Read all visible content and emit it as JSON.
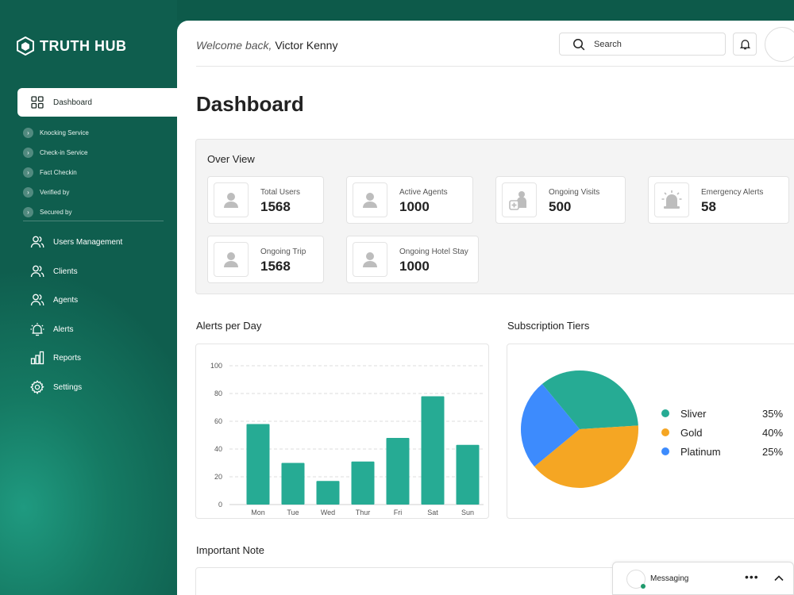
{
  "brand": {
    "name": "TRUTH HUB"
  },
  "sidebar": {
    "active": {
      "label": "Dashboard",
      "icon": "grid-icon"
    },
    "subitems": [
      {
        "label": "Knocking Service"
      },
      {
        "label": "Check-in Service"
      },
      {
        "label": "Fact Checkin"
      },
      {
        "label": "Verified by"
      },
      {
        "label": "Secured by"
      }
    ],
    "items": [
      {
        "label": "Users Management",
        "icon": "users-icon"
      },
      {
        "label": "Clients",
        "icon": "users-icon"
      },
      {
        "label": "Agents",
        "icon": "users-icon"
      },
      {
        "label": "Alerts",
        "icon": "alarm-icon"
      },
      {
        "label": "Reports",
        "icon": "bar-chart-icon"
      },
      {
        "label": "Settings",
        "icon": "gear-icon"
      }
    ]
  },
  "header": {
    "welcome": "Welcome back,",
    "user_name": "Victor Kenny",
    "search_placeholder": "Search"
  },
  "page": {
    "title": "Dashboard"
  },
  "overview": {
    "title": "Over View",
    "stats": [
      {
        "label": "Total Users",
        "value": "1568",
        "icon": "user-icon"
      },
      {
        "label": "Active Agents",
        "value": "1000",
        "icon": "user-icon"
      },
      {
        "label": "Ongoing Visits",
        "value": "500",
        "icon": "medical-visit-icon"
      },
      {
        "label": "Emergency Alerts",
        "value": "58",
        "icon": "siren-icon"
      },
      {
        "label": "Ongoing Trip",
        "value": "1568",
        "icon": "user-icon"
      },
      {
        "label": "Ongoing Hotel Stay",
        "value": "1000",
        "icon": "user-icon"
      }
    ]
  },
  "alerts_title": "Alerts per Day",
  "subscription_title": "Subscription Tiers",
  "note_title": "Important Note",
  "messaging": {
    "label": "Messaging"
  },
  "colors": {
    "sidebar": "#0f5e4e",
    "accent": "#26ab94",
    "gold": "#f5a623",
    "platinum": "#3d8bfd"
  },
  "chart_data": [
    {
      "type": "bar",
      "title": "Alerts per Day",
      "categories": [
        "Mon",
        "Tue",
        "Wed",
        "Thur",
        "Fri",
        "Sat",
        "Sun"
      ],
      "values": [
        58,
        30,
        17,
        31,
        48,
        78,
        43
      ],
      "yticks": [
        0,
        20,
        40,
        60,
        80,
        100
      ],
      "ylim": [
        0,
        100
      ],
      "grid": true,
      "color": "#26ab94"
    },
    {
      "type": "pie",
      "title": "Subscription Tiers",
      "slices": [
        {
          "label": "Sliver",
          "value": 35,
          "pct": "35%",
          "color": "#26ab94"
        },
        {
          "label": "Gold",
          "value": 40,
          "pct": "40%",
          "color": "#f5a623"
        },
        {
          "label": "Platinum",
          "value": 25,
          "pct": "25%",
          "color": "#3d8bfd"
        }
      ],
      "legend": "right"
    }
  ]
}
